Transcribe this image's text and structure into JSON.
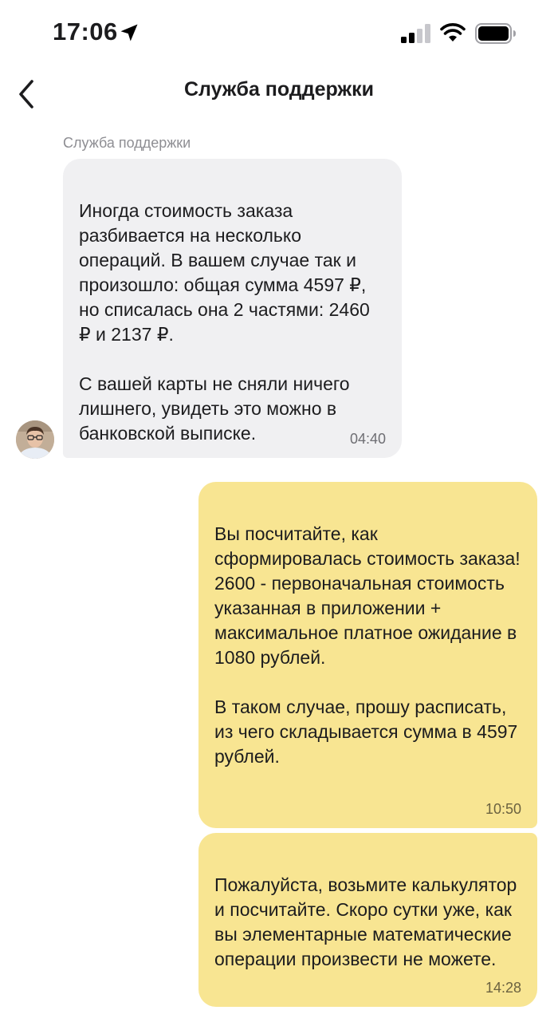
{
  "status_bar": {
    "time": "17:06",
    "icons": [
      "location-arrow-icon",
      "cellular-signal-icon",
      "wifi-icon",
      "battery-icon"
    ]
  },
  "header": {
    "title": "Служба поддержки",
    "back_icon": "chevron-left-icon"
  },
  "messages": [
    {
      "direction": "incoming",
      "sender": "Служба поддержки",
      "text": "Иногда стоимость заказа разбивается на несколько операций. В вашем случае так и произошло: общая сумма 4597 ₽, но списалась она 2 частями: 2460 ₽ и 2137 ₽.\n\nС вашей карты не сняли ничего лишнего, увидеть это можно в банковской выписке.",
      "time": "04:40"
    },
    {
      "direction": "outgoing",
      "text": "Вы посчитайте, как сформировалась стоимость заказа!\n2600 - первоначальная стоимость указанная в приложении + максимальное платное ожидание в 1080 рублей.\n\nВ таком случае, прошу расписать, из чего складывается сумма в 4597 рублей.",
      "time": "10:50"
    },
    {
      "direction": "outgoing",
      "text": "Пожалуйста, возьмите калькулятор и посчитайте. Скоро сутки уже, как вы элементарные математические операции произвести не можете.",
      "time": "14:28"
    }
  ],
  "colors": {
    "incoming_bubble": "#f0f0f2",
    "outgoing_bubble": "#f8e592",
    "secondary_text": "#8e8e93"
  }
}
